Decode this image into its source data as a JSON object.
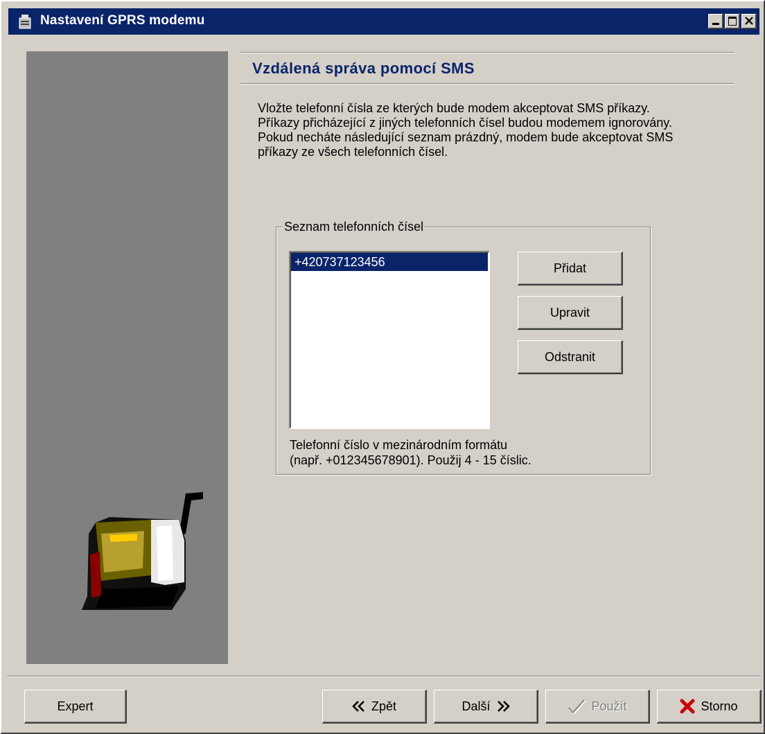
{
  "window": {
    "title": "Nastavení GPRS modemu",
    "icon": "modem-app-icon"
  },
  "page": {
    "heading": "Vzdálená správa pomocí SMS",
    "description": "Vložte telefonní čísla ze kterých bude modem akceptovat SMS příkazy. Příkazy přicházející z jiných telefonních čísel budou modemem ignorovány. Pokud necháte následující seznam prázdný, modem bude akceptovat SMS příkazy ze všech telefonních čísel."
  },
  "phone_group": {
    "legend": "Seznam telefonních čísel",
    "numbers": [
      "+420737123456"
    ],
    "selected_index": 0,
    "buttons": {
      "add": "Přidat",
      "edit": "Upravit",
      "remove": "Odstranit"
    },
    "hint_line1": "Telefonní číslo v mezinárodním formátu",
    "hint_line2": "(např. +012345678901). Použij 4 - 15 číslic."
  },
  "footer": {
    "expert": "Expert",
    "back": "Zpět",
    "next": "Další",
    "apply": "Použít",
    "cancel": "Storno",
    "apply_enabled": false
  },
  "colors": {
    "title_bar": "#0a246a",
    "selection": "#0a246a",
    "face": "#d4d0c8",
    "side_panel": "#808080",
    "cancel_icon": "#cc0000"
  }
}
